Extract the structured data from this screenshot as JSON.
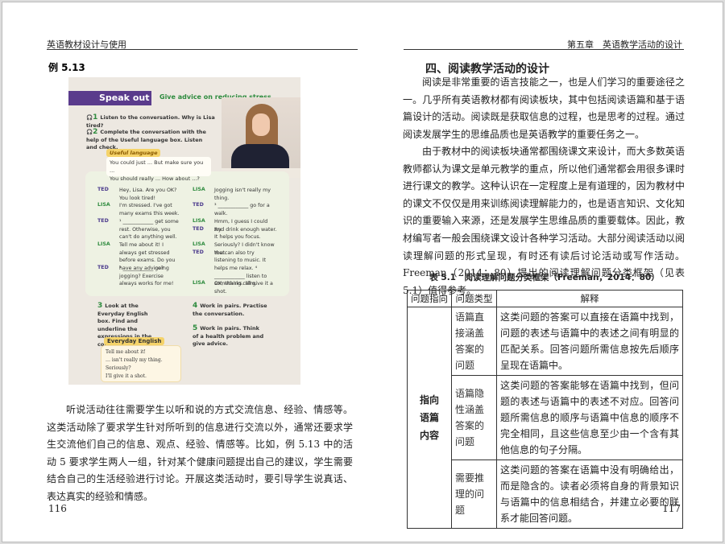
{
  "left_page": {
    "header": "英语教材设计与使用",
    "example_label": "例 5.13",
    "textbook": {
      "section_title": "Speak out",
      "section_subtitle": "Give advice on reducing stress",
      "task1_num": "1",
      "task1": "Listen to the conversation. Why is Lisa tired?",
      "task2_num": "2",
      "task2": "Complete the conversation with the help of the Useful language box. Listen and check.",
      "useful_language_label": "Useful language",
      "useful_language_line1": "You could just ...    But make sure you ...",
      "useful_language_line2": "You should really ...    How about ...?",
      "dialogue_left": [
        {
          "speaker": "TED",
          "text": "Hey, Lisa. Are you OK? You look tired!"
        },
        {
          "speaker": "LISA",
          "text": "I'm stressed. I've got many exams this week."
        },
        {
          "speaker": "TED",
          "text": "¹ ____________ get some rest. Otherwise, you can't do anything well."
        },
        {
          "speaker": "LISA",
          "text": "Tell me about it! I always get stressed before exams. Do you have any advice?"
        },
        {
          "speaker": "TED",
          "text": "² ____________ going jogging? Exercise always works for me!"
        }
      ],
      "dialogue_right": [
        {
          "speaker": "LISA",
          "text": "Jogging isn't really my thing."
        },
        {
          "speaker": "TED",
          "text": "³ ____________ go for a walk."
        },
        {
          "speaker": "LISA",
          "text": "Hmm, I guess I could try."
        },
        {
          "speaker": "TED",
          "text": "And drink enough water. It helps you focus."
        },
        {
          "speaker": "LISA",
          "text": "Seriously? I didn't know that."
        },
        {
          "speaker": "TED",
          "text": "You can also try listening to music. It helps me relax. ⁴ ____________ listen to something calm."
        },
        {
          "speaker": "LISA",
          "text": "OK, thanks. I'll give it a shot."
        }
      ],
      "task3_num": "3",
      "task3": "Look at the Everyday English box. Find and underline the expressions in the conversation.",
      "task4_num": "4",
      "task4": "Work in pairs. Practise the conversation.",
      "task5_num": "5",
      "task5": "Work in pairs. Think of a health problem and give advice.",
      "everyday_english_label": "Everyday English",
      "everyday_english": [
        "Tell me about it!",
        "… isn't really my thing.",
        "Seriously?",
        "I'll give it a shot."
      ]
    },
    "paragraph": "听说活动往往需要学生以听和说的方式交流信息、经验、情感等。这类活动除了要求学生针对所听到的信息进行交流以外，通常还要求学生交流他们自己的信息、观点、经验、情感等。比如，例 5.13 中的活动 5 要求学生两人一组，针对某个健康问题提出自己的建议，学生需要结合自己的生活经验进行讨论。开展这类活动时，要引导学生说真话、表达真实的经验和情感。",
    "page_number": "116"
  },
  "right_page": {
    "header": "第五章　英语教学活动的设计",
    "section_heading": "四、阅读教学活动的设计",
    "paragraph1": "阅读是非常重要的语言技能之一，也是人们学习的重要途径之一。几乎所有英语教材都有阅读板块，其中包括阅读语篇和基于语篇设计的活动。阅读既是获取信息的过程，也是思考的过程。通过阅读发展学生的思维品质也是英语教学的重要任务之一。",
    "paragraph2": "由于教材中的阅读板块通常都围绕课文来设计，而大多数英语教师都认为课文是单元教学的重点，所以他们通常都会用很多课时进行课文的教学。这种认识在一定程度上是有道理的，因为教材中的课文不仅仅是用来训练阅读理解能力的，也是语言知识、文化知识的重要输入来源，还是发展学生思维品质的重要载体。因此，教材编写者一般会围绕课文设计各种学习活动。大部分阅读活动以阅读理解问题的形式呈现，有时还有读后讨论活动或写作活动。Freeman（2014：80）提出的阅读理解问题分类框架（见表 5.1）值得参考。",
    "table_caption": "表 5.1　阅读理解问题分类框架（Freeman，2014：80）",
    "table": {
      "headers": [
        "问题指向",
        "问题类型",
        "解释"
      ],
      "group": "指向语篇内容",
      "rows": [
        {
          "type": "语篇直接涵盖答案的问题",
          "explanation": "这类问题的答案可以直接在语篇中找到，问题的表述与语篇中的表述之间有明显的匹配关系。回答问题所需信息按先后顺序呈现在语篇中。"
        },
        {
          "type": "语篇隐性涵盖答案的问题",
          "explanation": "这类问题的答案能够在语篇中找到，但问题的表述与语篇中的表述不对应。回答问题所需信息的顺序与语篇中信息的顺序不完全相同，且这些信息至少由一个含有其他信息的句子分隔。"
        },
        {
          "type": "需要推理的问题",
          "explanation": "这类问题的答案在语篇中没有明确给出，而是隐含的。读者必须将自身的背景知识与语篇中的信息相结合，并建立必要的联系才能回答问题。"
        }
      ]
    },
    "page_number": "117"
  }
}
